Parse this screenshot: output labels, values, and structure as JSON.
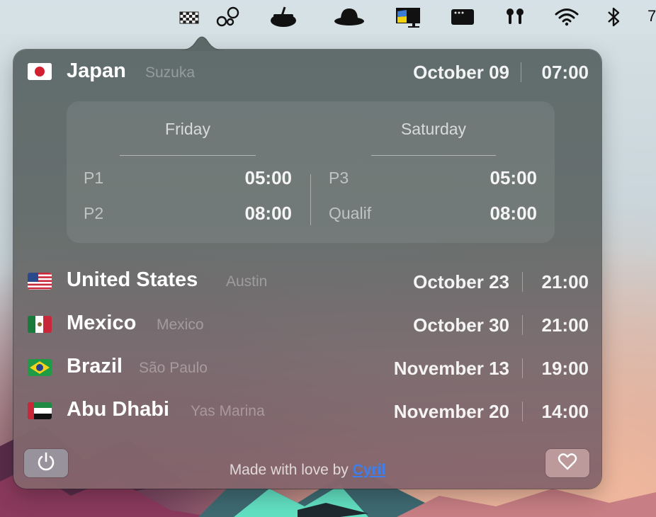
{
  "menubar": {
    "icons": [
      "checkered-flag-icon",
      "bubbles-icon",
      "pot-icon",
      "bowler-hat-icon",
      "ukraine-monitor-icon",
      "window-icon",
      "airpods-icon",
      "wifi-icon",
      "bluetooth-icon"
    ],
    "clock_partial": "7"
  },
  "next_race": {
    "country": "Japan",
    "city": "Suzuka",
    "date": "October 09",
    "time": "07:00",
    "flag": "japan-flag-icon",
    "sessions": {
      "days": [
        {
          "label": "Friday",
          "entries": [
            {
              "name": "P1",
              "time": "05:00"
            },
            {
              "name": "P2",
              "time": "08:00"
            }
          ]
        },
        {
          "label": "Saturday",
          "entries": [
            {
              "name": "P3",
              "time": "05:00"
            },
            {
              "name": "Qualif",
              "time": "08:00"
            }
          ]
        }
      ]
    }
  },
  "races": [
    {
      "country": "United States",
      "city": "Austin",
      "date": "October 23",
      "time": "21:00",
      "flag": "usa-flag-icon"
    },
    {
      "country": "Mexico",
      "city": "Mexico",
      "date": "October 30",
      "time": "21:00",
      "flag": "mexico-flag-icon"
    },
    {
      "country": "Brazil",
      "city": "São Paulo",
      "date": "November 13",
      "time": "19:00",
      "flag": "brazil-flag-icon"
    },
    {
      "country": "Abu Dhabi",
      "city": "Yas Marina",
      "date": "November 20",
      "time": "14:00",
      "flag": "uae-flag-icon"
    }
  ],
  "footer": {
    "text": "Made with love by",
    "link": "Cyril"
  },
  "colors": {
    "link": "#3b7ff0",
    "popover_top": "#5c6868",
    "popover_bottom": "#86646c"
  }
}
